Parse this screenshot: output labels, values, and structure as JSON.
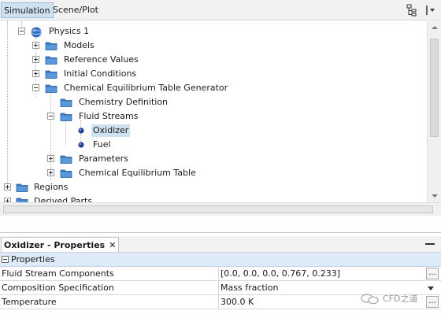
{
  "tabs": {
    "simulation": "Simulation",
    "scene_plot": "Scene/Plot"
  },
  "tree": {
    "physics1": "Physics 1",
    "models": "Models",
    "reference_values": "Reference Values",
    "initial_conditions": "Initial Conditions",
    "cetg": "Chemical Equilibrium Table Generator",
    "chemistry_definition": "Chemistry Definition",
    "fluid_streams": "Fluid Streams",
    "oxidizer": "Oxidizer",
    "fuel": "Fuel",
    "parameters": "Parameters",
    "chemical_equilibrium_table": "Chemical Equilibrium Table",
    "regions": "Regions",
    "derived_parts": "Derived Parts"
  },
  "properties": {
    "title": "Oxidizer - Properties",
    "close": "✕",
    "group": "Properties",
    "rows": [
      {
        "name": "Fluid Stream Components",
        "value": "[0.0, 0.0, 0.0, 0.767, 0.233]",
        "control": "..."
      },
      {
        "name": "Composition Specification",
        "value": "Mass fraction"
      },
      {
        "name": "Temperature",
        "value": "300.0 K",
        "control": "..."
      }
    ]
  },
  "watermark": "CFD之道",
  "colors": {
    "selection": "#cfe0ef",
    "folder": "#3d7ec4",
    "node_dot": "#23409a",
    "physics_sphere": "#2f6fc0"
  }
}
